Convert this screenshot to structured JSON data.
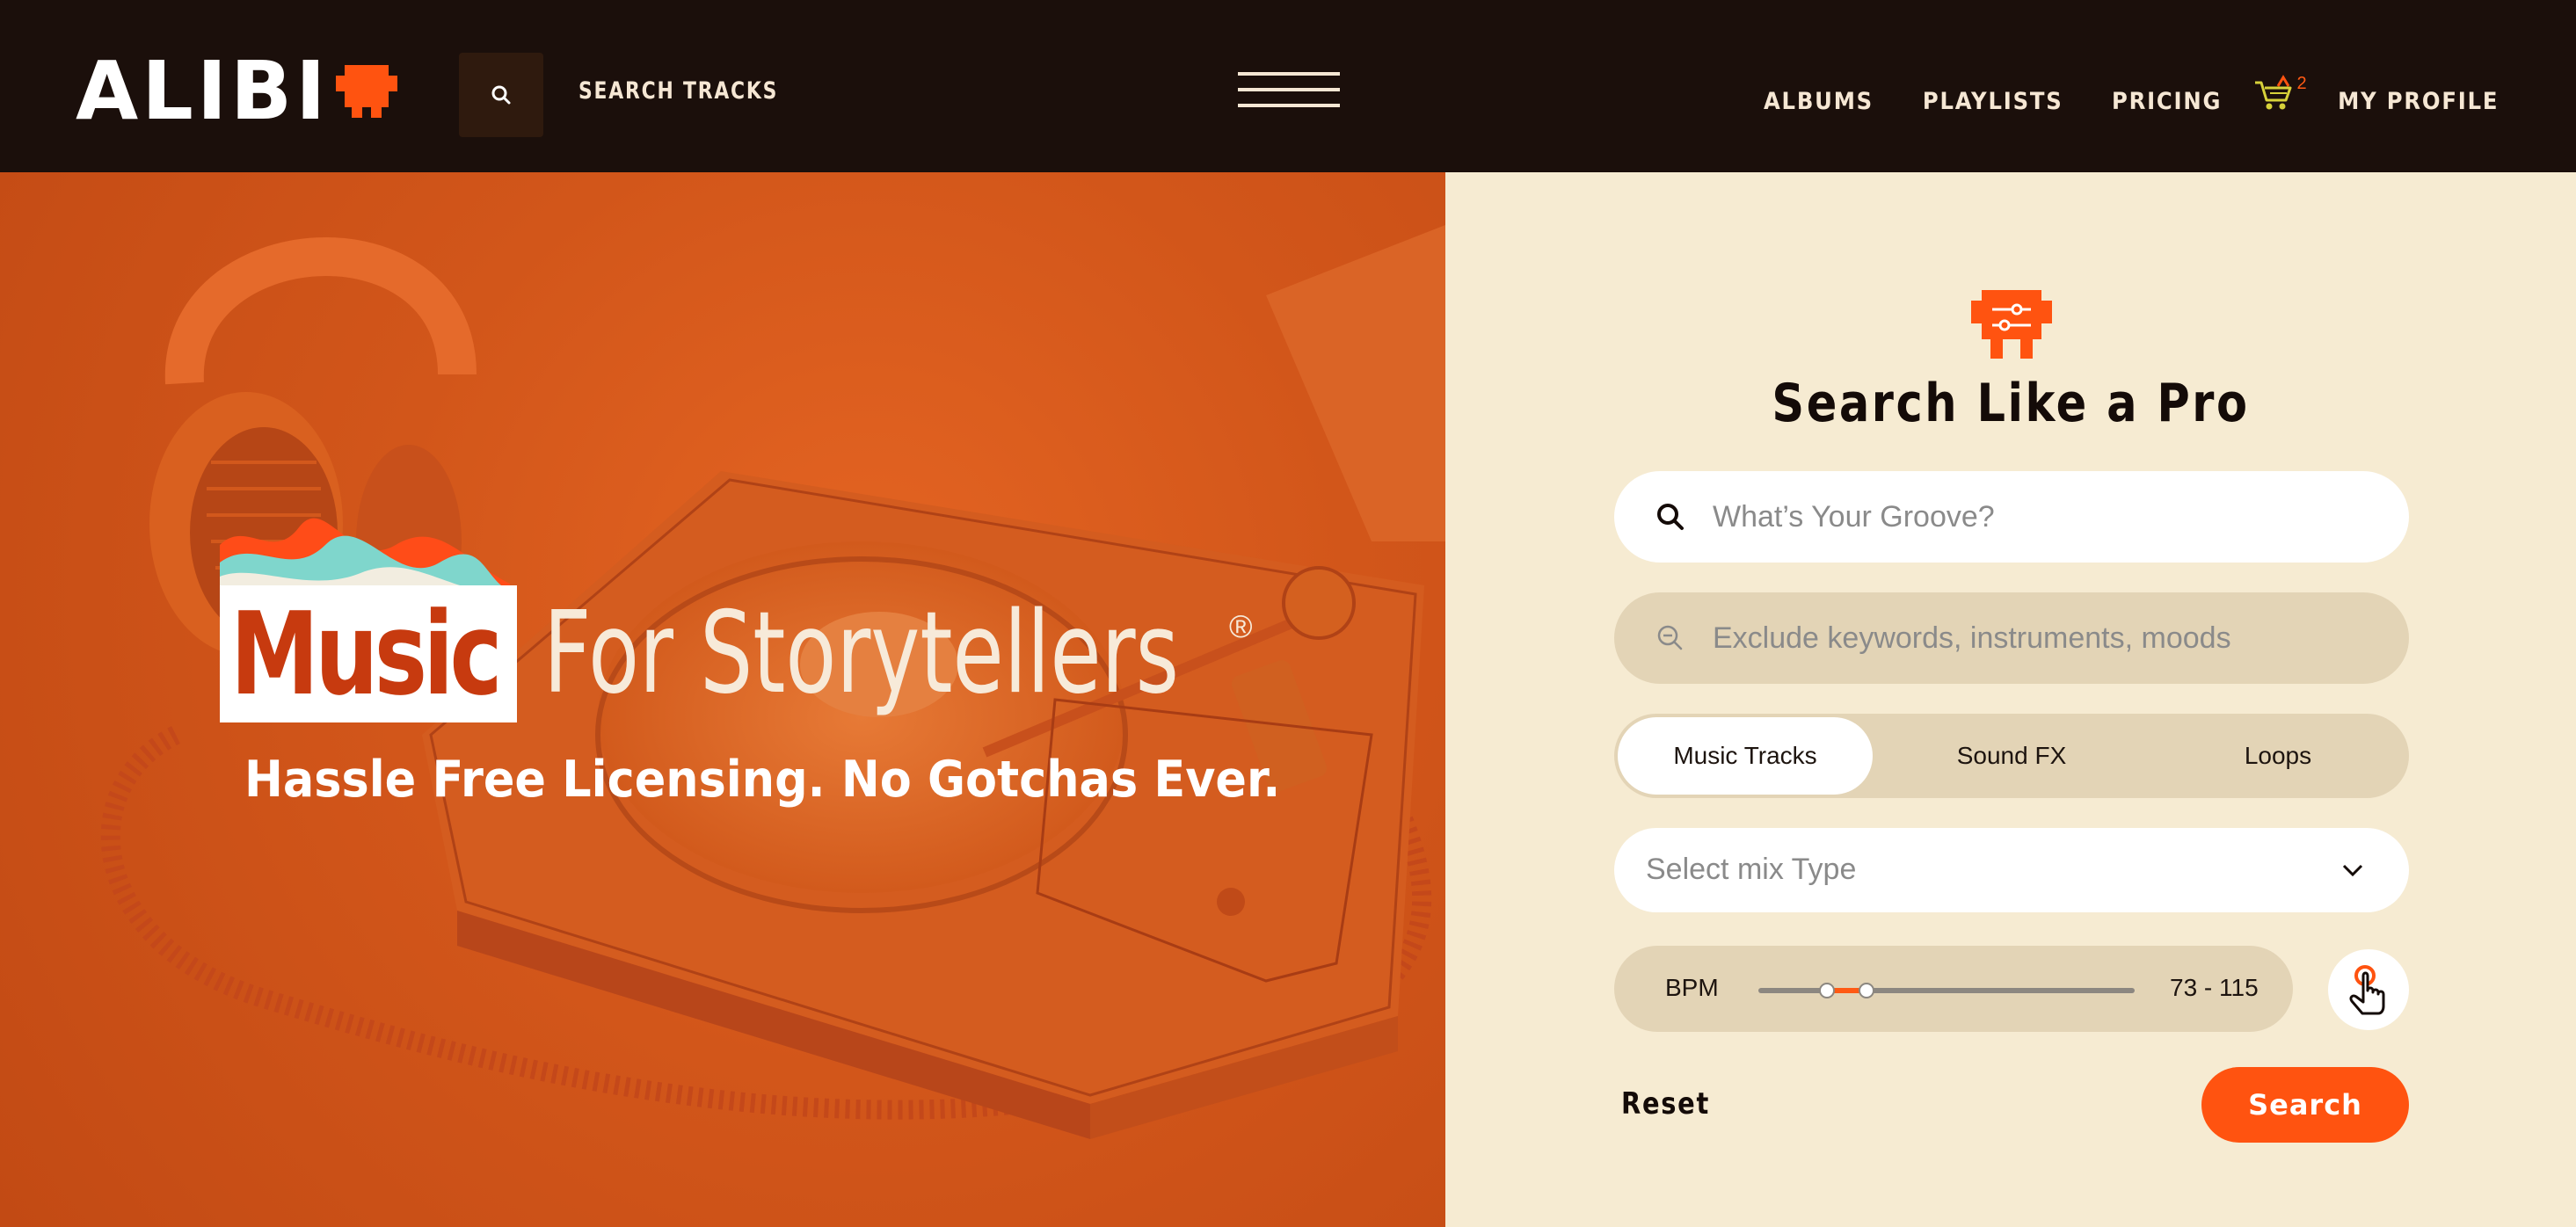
{
  "header": {
    "logo_text": "ALIBI",
    "search_label": "SEARCH TRACKS",
    "nav": {
      "albums": "ALBUMS",
      "playlists": "PLAYLISTS",
      "pricing": "PRICING",
      "cart_count": "2",
      "my_profile": "MY PROFILE"
    },
    "icons": [
      "search-icon",
      "hamburger-menu-icon",
      "cart-icon"
    ]
  },
  "hero": {
    "headline_box_word": "Music",
    "headline_rest": "For Storytellers",
    "registered_mark": "®",
    "subline": "Hassle Free Licensing. No Gotchas Ever."
  },
  "search_panel": {
    "title": "Search Like a Pro",
    "groove_placeholder": "What’s Your Groove?",
    "exclude_placeholder": "Exclude keywords, instruments, moods",
    "tabs": [
      {
        "label": "Music Tracks",
        "active": true
      },
      {
        "label": "Sound FX",
        "active": false
      },
      {
        "label": "Loops",
        "active": false
      }
    ],
    "mix_select": "Select mix Type",
    "bpm": {
      "label": "BPM",
      "range_text": "73 - 115",
      "min": 73,
      "max": 115
    },
    "reset_label": "Reset",
    "search_label": "Search"
  },
  "colors": {
    "accent": "#ff5310",
    "topbar_bg": "#1b0f0b",
    "panel_bg": "#f6ebd2",
    "hero_bg": "#d2561a",
    "field_tan": "#e3d4b6"
  }
}
